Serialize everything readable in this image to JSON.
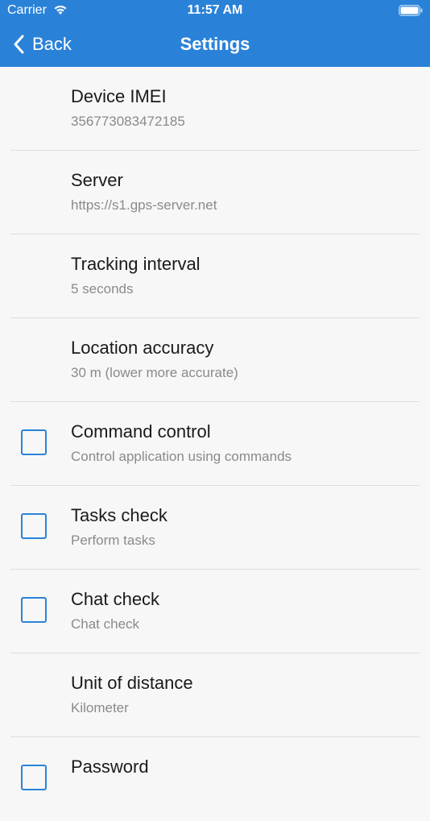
{
  "status_bar": {
    "carrier": "Carrier",
    "time": "11:57 AM"
  },
  "nav": {
    "back_label": "Back",
    "title": "Settings"
  },
  "settings": [
    {
      "label": "Device IMEI",
      "value": "356773083472185",
      "checkbox": false
    },
    {
      "label": "Server",
      "value": "https://s1.gps-server.net",
      "checkbox": false
    },
    {
      "label": "Tracking interval",
      "value": "5 seconds",
      "checkbox": false
    },
    {
      "label": "Location accuracy",
      "value": "30 m (lower more accurate)",
      "checkbox": false
    },
    {
      "label": "Command control",
      "value": "Control application using commands",
      "checkbox": true,
      "checked": false
    },
    {
      "label": "Tasks check",
      "value": "Perform tasks",
      "checkbox": true,
      "checked": false
    },
    {
      "label": "Chat check",
      "value": "Chat check",
      "checkbox": true,
      "checked": false
    },
    {
      "label": "Unit of distance",
      "value": "Kilometer",
      "checkbox": false
    },
    {
      "label": "Password",
      "value": "",
      "checkbox": true,
      "checked": false
    }
  ],
  "colors": {
    "accent": "#2a82d8",
    "background": "#f7f7f7"
  }
}
